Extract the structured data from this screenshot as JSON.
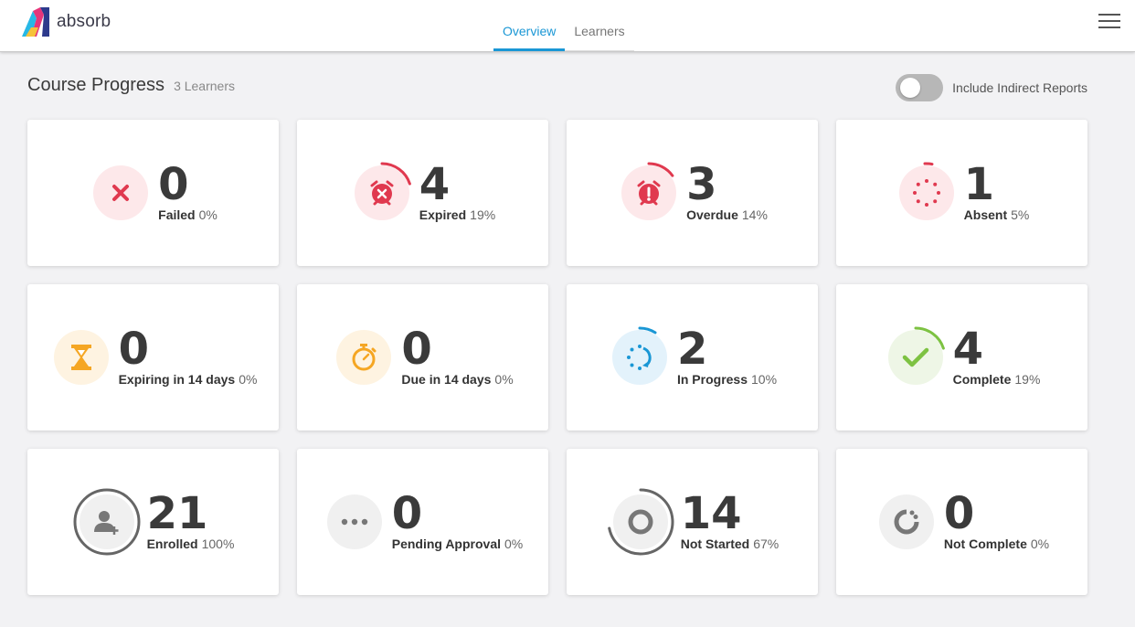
{
  "header": {
    "logo_text": "absorb",
    "tabs": [
      {
        "label": "Overview",
        "active": true
      },
      {
        "label": "Learners",
        "active": false
      }
    ]
  },
  "page": {
    "title": "Course Progress",
    "subtitle": "3 Learners",
    "toggle_label": "Include Indirect Reports",
    "toggle_on": false
  },
  "cards": [
    {
      "value": "0",
      "label": "Failed",
      "percent": "0%",
      "icon": "x-icon",
      "color": "#e0394f"
    },
    {
      "value": "4",
      "label": "Expired",
      "percent": "19%",
      "icon": "alarm-clock-x-icon",
      "color": "#e0394f"
    },
    {
      "value": "3",
      "label": "Overdue",
      "percent": "14%",
      "icon": "alarm-clock-exclamation-icon",
      "color": "#e0394f"
    },
    {
      "value": "1",
      "label": "Absent",
      "percent": "5%",
      "icon": "dotted-circle-icon",
      "color": "#e0394f"
    },
    {
      "value": "0",
      "label": "Expiring in 14 days",
      "percent": "0%",
      "icon": "hourglass-icon",
      "color": "#f5a623"
    },
    {
      "value": "0",
      "label": "Due in 14 days",
      "percent": "0%",
      "icon": "stopwatch-icon",
      "color": "#f5a623"
    },
    {
      "value": "2",
      "label": "In Progress",
      "percent": "10%",
      "icon": "progress-arrow-icon",
      "color": "#1a97d5"
    },
    {
      "value": "4",
      "label": "Complete",
      "percent": "19%",
      "icon": "checkmark-icon",
      "color": "#7dc242"
    },
    {
      "value": "21",
      "label": "Enrolled",
      "percent": "100%",
      "icon": "user-plus-icon",
      "color": "#666666"
    },
    {
      "value": "0",
      "label": "Pending Approval",
      "percent": "0%",
      "icon": "ellipsis-icon",
      "color": "#666666"
    },
    {
      "value": "14",
      "label": "Not Started",
      "percent": "67%",
      "icon": "ring-icon",
      "color": "#666666"
    },
    {
      "value": "0",
      "label": "Not Complete",
      "percent": "0%",
      "icon": "partial-circle-icon",
      "color": "#666666"
    }
  ]
}
